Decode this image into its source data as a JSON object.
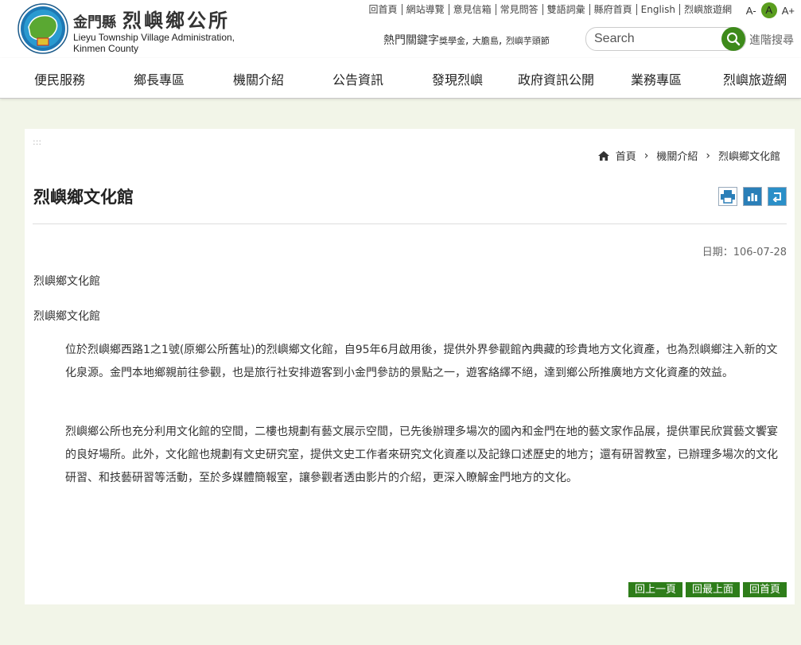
{
  "header": {
    "brand_county": "金門縣",
    "brand_office": "烈嶼鄉公所",
    "brand_en_line1": "Lieyu Township Village Administration,",
    "brand_en_line2": "Kinmen County",
    "top_links": [
      "回首頁",
      "網站導覽",
      "意見信箱",
      "常見問答",
      "雙語詞彙",
      "縣府首頁",
      "English",
      "烈嶼旅遊網"
    ],
    "font_small": "A-",
    "font_mid": "A",
    "font_large": "A+",
    "hot_label": "熱門關鍵字",
    "hot_kw1": "獎學金",
    "hot_kw2": "大膽島",
    "hot_kw3": "烈嶼芋頭節",
    "search_placeholder": "Search",
    "advanced_search": "進階搜尋"
  },
  "nav": [
    "便民服務",
    "鄉長專區",
    "機關介紹",
    "公告資訊",
    "發現烈嶼",
    "政府資訊公開",
    "業務專區",
    "烈嶼旅遊網"
  ],
  "content": {
    "access_key": ":::",
    "breadcrumb": [
      "首頁",
      "機關介紹",
      "烈嶼鄉文化館"
    ],
    "title": "烈嶼鄉文化館",
    "date": "日期：106-07-28",
    "subtitle1": "烈嶼鄉文化館",
    "subtitle2": "烈嶼鄉文化館",
    "para1": "位於烈嶼鄉西路1之1號(原鄉公所舊址)的烈嶼鄉文化館，自95年6月啟用後，提供外界參觀館內典藏的珍貴地方文化資產，也為烈嶼鄉注入新的文化泉源。金門本地鄉親前往參觀，也是旅行社安排遊客到小金門參訪的景點之一，遊客絡繹不絕，達到鄉公所推廣地方文化資產的效益。",
    "para2": "烈嶼鄉公所也充分利用文化館的空間，二樓也規劃有藝文展示空間，已先後辦理多場次的國內和金門在地的藝文家作品展，提供軍民欣賞藝文饗宴的良好場所。此外，文化館也規劃有文史研究室，提供文史工作者來研究文化資產以及記錄口述歷史的地方；還有研習教室，已辦理多場次的文化研習、和技藝研習等活動，至於多媒體簡報室，讓參觀者透由影片的介紹，更深入瞭解金門地方的文化。",
    "btn_back": "回上一頁",
    "btn_top": "回最上面",
    "btn_home": "回首頁"
  },
  "colors": {
    "accent": "#2e7d1a",
    "page_bg": "#f2f5e8"
  }
}
